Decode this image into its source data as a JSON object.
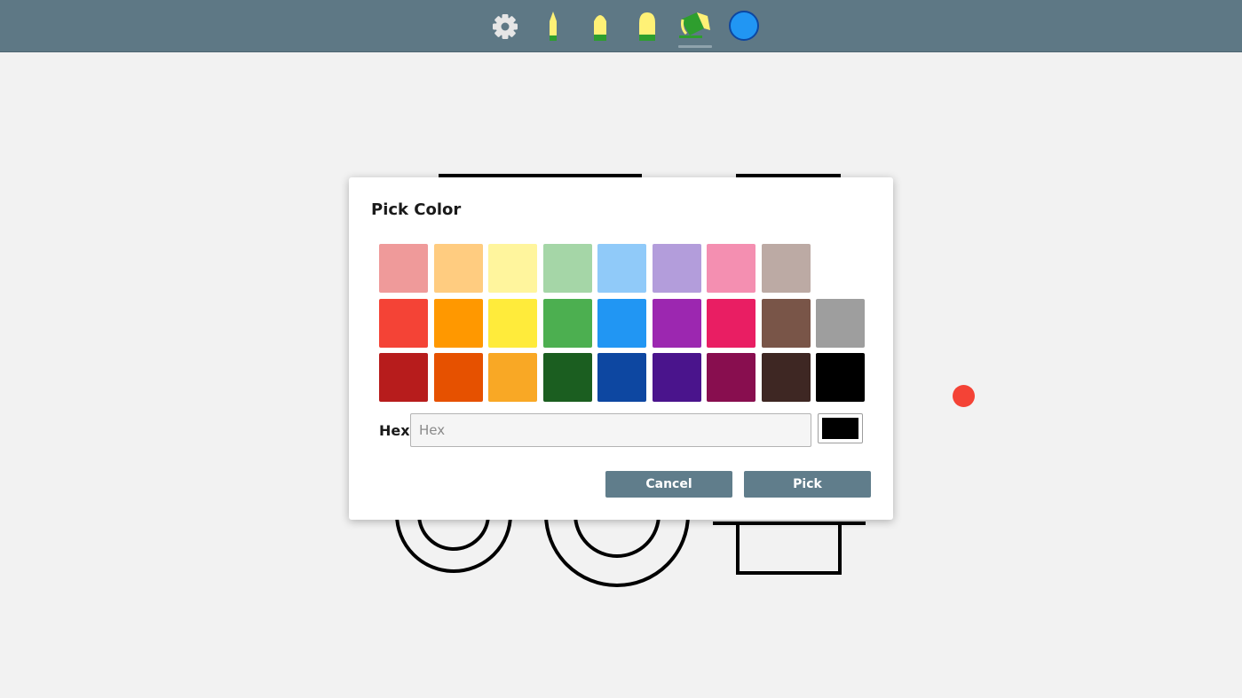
{
  "toolbar": {
    "tools": [
      {
        "name": "settings",
        "icon": "gear-icon"
      },
      {
        "name": "pen-thin",
        "icon": "pen-thin-icon"
      },
      {
        "name": "pen-medium",
        "icon": "pen-medium-icon"
      },
      {
        "name": "pen-thick",
        "icon": "pen-thick-icon"
      },
      {
        "name": "fill",
        "icon": "paint-bucket-icon",
        "selected": true
      },
      {
        "name": "color",
        "icon": "color-circle-icon",
        "color": "#2196f3"
      }
    ]
  },
  "dialog": {
    "title": "Pick Color",
    "palette": [
      [
        "#ef9a9a",
        "#ffcc80",
        "#fff59d",
        "#a5d6a7",
        "#90caf9",
        "#b39ddb",
        "#f48fb1",
        "#bcaaa4"
      ],
      [
        "#f44336",
        "#ff9800",
        "#ffeb3b",
        "#4caf50",
        "#2196f3",
        "#9c27b0",
        "#e91e63",
        "#795548",
        "#9e9e9e"
      ],
      [
        "#b71c1c",
        "#e65100",
        "#f9a825",
        "#1b5e20",
        "#0d47a1",
        "#4a148c",
        "#880e4f",
        "#3e2723",
        "#000000"
      ]
    ],
    "hex_label": "Hex",
    "hex_value": "",
    "hex_placeholder": "Hex",
    "preview_color": "#000000",
    "cancel_label": "Cancel",
    "pick_label": "Pick"
  },
  "canvas": {
    "stroke_color": "#000000",
    "dot_color": "#f44336"
  },
  "colors": {
    "toolbar_bg": "#5e7885",
    "button_bg": "#607d8b",
    "canvas_bg": "#f2f2f2"
  }
}
